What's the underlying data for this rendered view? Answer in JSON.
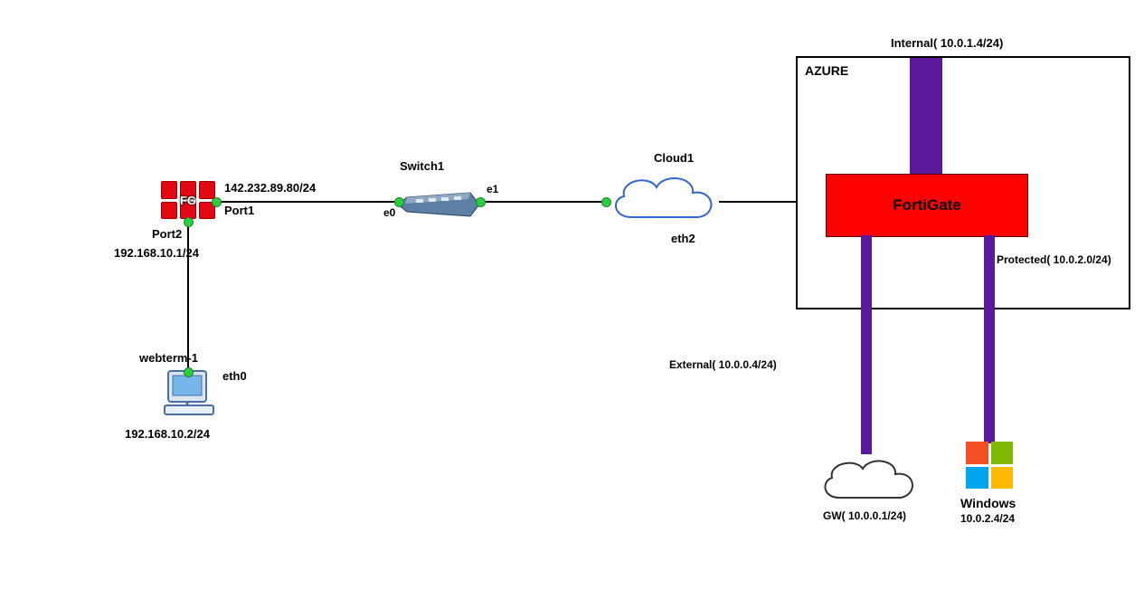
{
  "azure": {
    "title": "AZURE",
    "internal_label": "Internal( 10.0.1.4/24)",
    "protected_label": "Protected( 10.0.2.0/24)",
    "external_label": "External( 10.0.0.4/24)",
    "fortigate_label": "FortiGate",
    "gw_label": "GW( 10.0.0.1/24)",
    "windows_label": "Windows",
    "windows_ip": "10.0.2.4/24"
  },
  "cloud1": {
    "name": "Cloud1",
    "iface": "eth2"
  },
  "switch1": {
    "name": "Switch1",
    "left_iface": "e0",
    "right_iface": "e1"
  },
  "fg": {
    "icon_label": "FG",
    "port1_label": "Port1",
    "port1_ip": "142.232.89.80/24",
    "port2_label": "Port2",
    "port2_ip": "192.168.10.1/24"
  },
  "webterm": {
    "name": "webterm-1",
    "iface": "eth0",
    "ip": "192.168.10.2/24"
  }
}
